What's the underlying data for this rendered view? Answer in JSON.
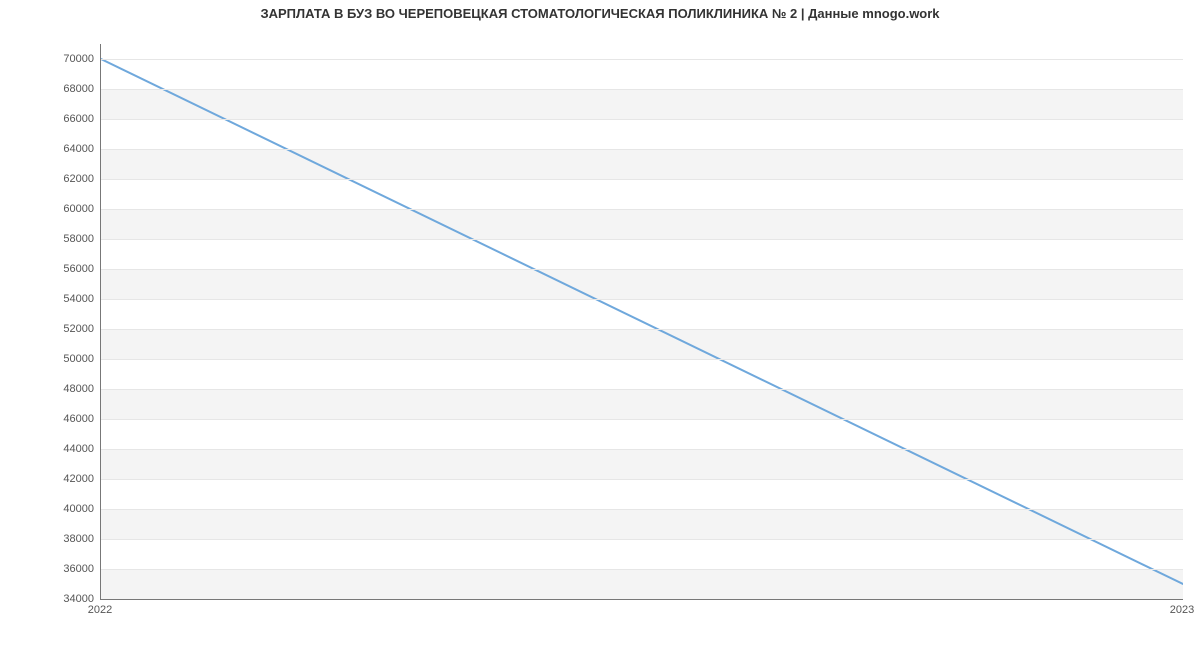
{
  "chart_data": {
    "type": "line",
    "title": "ЗАРПЛАТА В БУЗ ВО ЧЕРЕПОВЕЦКАЯ СТОМАТОЛОГИЧЕСКАЯ ПОЛИКЛИНИКА № 2 | Данные mnogo.work",
    "x": [
      "2022",
      "2023"
    ],
    "values": [
      70000,
      35000
    ],
    "xlabel": "",
    "ylabel": "",
    "ylim": [
      34000,
      71000
    ],
    "yticks": [
      34000,
      36000,
      38000,
      40000,
      42000,
      44000,
      46000,
      48000,
      50000,
      52000,
      54000,
      56000,
      58000,
      60000,
      62000,
      64000,
      66000,
      68000,
      70000
    ],
    "line_color": "#6fa8dc"
  }
}
